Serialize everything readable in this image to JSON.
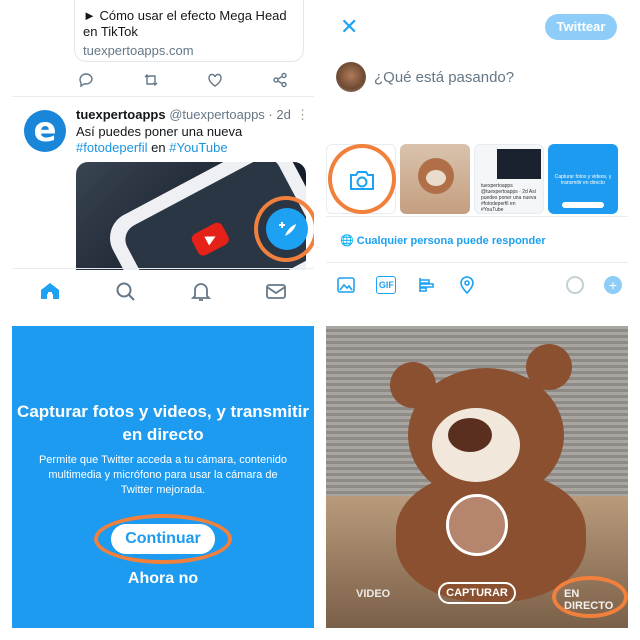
{
  "feed": {
    "prev_card_title": "► Cómo usar el efecto Mega Head en TikTok",
    "prev_card_domain": "tuexpertoapps.com",
    "tweet": {
      "display_name": "tuexpertoapps",
      "handle": "@tuexpertoapps · 2d",
      "text_line": "Así puedes poner una nueva",
      "hashtag1": "#fotodeperfil",
      "en": " en ",
      "hashtag2": "#YouTube",
      "avatar_letter": "e"
    },
    "fab_icon": "compose-plus-icon",
    "nav": [
      "home-icon",
      "search-icon",
      "bell-icon",
      "mail-icon"
    ]
  },
  "compose": {
    "tweet_button": "Twittear",
    "placeholder": "¿Qué está pasando?",
    "reply_setting": "Cualquier persona puede responder",
    "thumb_screen_text": "tuexpertoapps @tuexpertoapps · 2d Así puedes poner una nueva #fotodeperfil en #YouTube",
    "thumb_blue_text": "Capturar fotos y videos, y transmitir en directo",
    "tools": [
      "image-icon",
      "gif-icon",
      "poll-icon",
      "location-icon"
    ],
    "gif_label": "GIF"
  },
  "permission": {
    "title": "Capturar fotos y videos, y transmitir en directo",
    "body": "Permite que Twitter acceda a tu cámara, contenido multimedia y micrófono para usar la cámara de Twitter mejorada.",
    "continue": "Continuar",
    "later": "Ahora no"
  },
  "camera": {
    "modes": [
      "VIDEO",
      "CAPTURAR",
      "EN DIRECTO"
    ]
  },
  "colors": {
    "accent": "#1da1f2",
    "highlight": "#f0803c"
  }
}
